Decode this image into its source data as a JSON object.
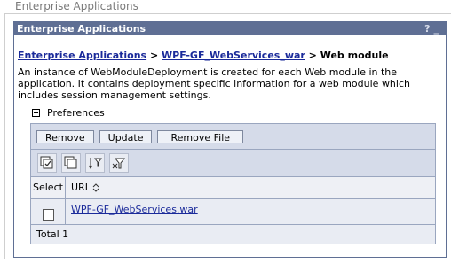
{
  "outer_title": "Enterprise Applications",
  "portlet": {
    "title": "Enterprise Applications",
    "help_label": "?",
    "minimize_label": "_"
  },
  "breadcrumb": {
    "link1": "Enterprise Applications",
    "sep1": " > ",
    "link2": "WPF-GF_WebServices_war",
    "sep2": " > ",
    "current": "Web module"
  },
  "description": "An instance of WebModuleDeployment is created for each Web module in the application. It contains deployment specific information for a web module which includes session management settings.",
  "preferences_label": "Preferences",
  "buttons": {
    "remove": "Remove",
    "update": "Update",
    "remove_file": "Remove File"
  },
  "toolbar_icons": [
    "select-all-icon",
    "deselect-all-icon",
    "show-filter-icon",
    "clear-filter-icon"
  ],
  "table": {
    "col_select": "Select",
    "col_uri": "URI",
    "sort_icon": "sort-icon",
    "rows": [
      {
        "uri": "WPF-GF_WebServices.war"
      }
    ],
    "total_label": "Total 1"
  },
  "colors": {
    "title_bar": "#5f6f94",
    "bar_bg": "#d5dbe9",
    "row_bg": "#e9ecf3",
    "link": "#1a2a9a"
  }
}
